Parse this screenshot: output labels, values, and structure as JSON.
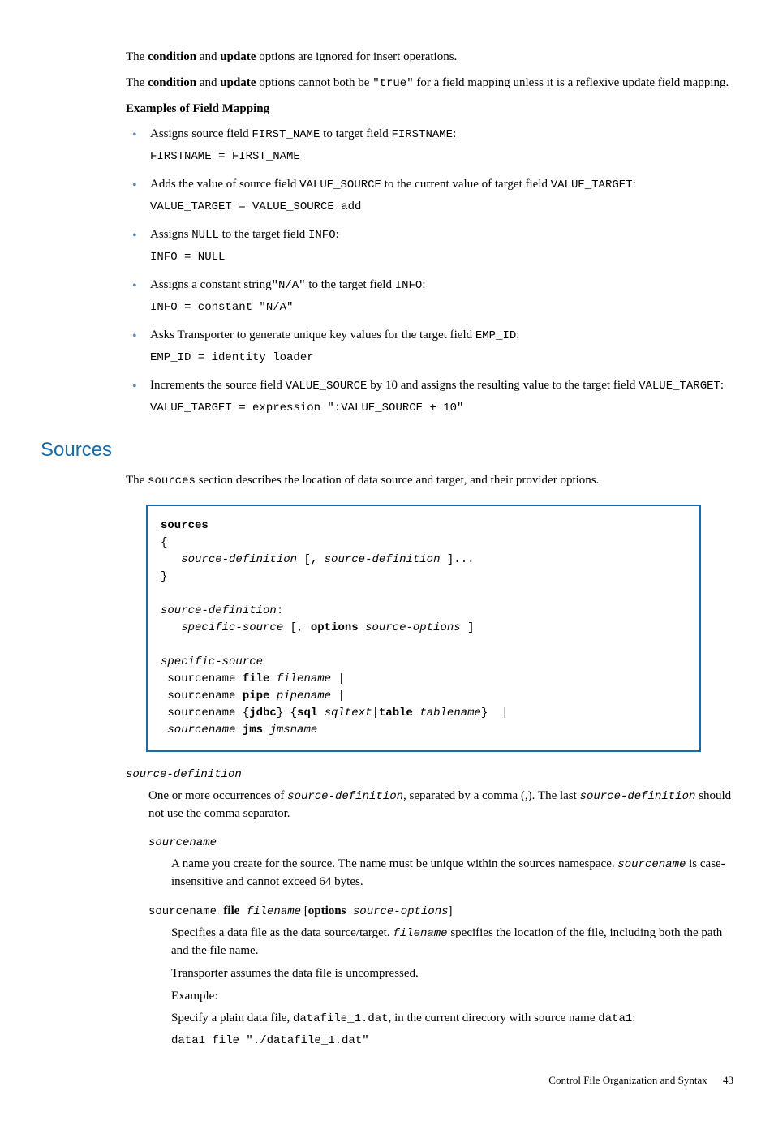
{
  "intro": {
    "p1_a": "The ",
    "p1_b": "condition",
    "p1_c": " and ",
    "p1_d": "update",
    "p1_e": " options are ignored for insert operations.",
    "p2_a": "The ",
    "p2_b": "condition",
    "p2_c": " and ",
    "p2_d": "update",
    "p2_e": " options cannot both be ",
    "p2_f": "\"true\"",
    "p2_g": " for a field mapping unless it is a reflexive update field mapping."
  },
  "examples_heading": "Examples of Field Mapping",
  "examples": [
    {
      "t1": "Assigns source field ",
      "c1": "FIRST_NAME",
      "t2": " to target field ",
      "c2": "FIRSTNAME",
      "t3": ":",
      "code": "FIRSTNAME = FIRST_NAME"
    },
    {
      "t1": "Adds the value of source field ",
      "c1": "VALUE_SOURCE",
      "t2": " to the current value of target field ",
      "c2": "VALUE_TARGET",
      "t3": ":",
      "code": "VALUE_TARGET = VALUE_SOURCE add"
    },
    {
      "t1": "Assigns ",
      "c1": "NULL",
      "t2": " to the target field ",
      "c2": "INFO",
      "t3": ":",
      "code": "INFO = NULL"
    },
    {
      "t1": "Assigns a constant string",
      "c1": "\"N/A\"",
      "t2": " to the target field ",
      "c2": "INFO",
      "t3": ":",
      "code": "INFO = constant \"N/A\""
    },
    {
      "t1": "Asks Transporter to generate unique key values for the target field ",
      "c1": "EMP_ID",
      "t2": "",
      "c2": "",
      "t3": ":",
      "code": "EMP_ID = identity loader"
    },
    {
      "t1": "Increments the source field ",
      "c1": "VALUE_SOURCE",
      "t2": " by 10 and assigns the resulting value to the target field ",
      "c2": "VALUE_TARGET",
      "t3": ":",
      "code": "VALUE_TARGET = expression \":VALUE_SOURCE + 10\""
    }
  ],
  "section_heading": "Sources",
  "section_intro_a": "The ",
  "section_intro_b": "sources",
  "section_intro_c": " section describes the location of data source and target, and their provider options.",
  "syntax": {
    "l01": "sources",
    "l02": "{",
    "l03a": "   ",
    "l03b": "source-definition",
    "l03c": " [, ",
    "l03d": "source-definition",
    "l03e": " ]...",
    "l04": "}",
    "l06": "source-definition",
    "l06b": ":",
    "l07a": "   ",
    "l07b": "specific-source",
    "l07c": " [, ",
    "l07d": "options",
    "l07e": " ",
    "l07f": "source-options",
    "l07g": " ]",
    "l09": "specific-source",
    "l10a": " sourcename ",
    "l10b": "file",
    "l10c": " ",
    "l10d": "filename",
    "l10e": " |",
    "l11a": " sourcename ",
    "l11b": "pipe",
    "l11c": " ",
    "l11d": "pipename",
    "l11e": " |",
    "l12a": " sourcename {",
    "l12b": "jdbc",
    "l12c": "} {",
    "l12d": "sql",
    "l12e": " ",
    "l12f": "sqltext",
    "l12g": "|",
    "l12h": "table",
    "l12i": " ",
    "l12j": "tablename",
    "l12k": "}  |",
    "l13a": " ",
    "l13b": "sourcename",
    "l13c": " ",
    "l13d": "jms",
    "l13e": " ",
    "l13f": "jmsname"
  },
  "defs": {
    "d1_term": "source-definition",
    "d1_def_a": "One or more occurrences of ",
    "d1_def_b": "source-definition",
    "d1_def_c": ", separated by a comma (,). The last ",
    "d1_def_d": "source-definition",
    "d1_def_e": " should not use the comma separator.",
    "d2_term": "sourcename",
    "d2_def_a": "A name you create for the source. The name must be unique within the sources namespace. ",
    "d2_def_b": "sourcename",
    "d2_def_c": " is case-insensitive and cannot exceed 64 bytes.",
    "d3_term_a": "sourcename ",
    "d3_term_b": "file",
    "d3_term_c": " ",
    "d3_term_d": "filename",
    "d3_term_e": " [",
    "d3_term_f": "options",
    "d3_term_g": " ",
    "d3_term_h": "source-options",
    "d3_term_i": "]",
    "d3_p1_a": "Specifies a data file as the data source/target. ",
    "d3_p1_b": "filename",
    "d3_p1_c": " specifies the location of the file, including both the path and the file name.",
    "d3_p2": "Transporter assumes the data file is uncompressed.",
    "d3_p3": "Example:",
    "d3_p4_a": "Specify a plain data file, ",
    "d3_p4_b": "datafile_1.dat",
    "d3_p4_c": ", in the current directory with source name ",
    "d3_p4_d": "data1",
    "d3_p4_e": ":",
    "d3_code": "data1 file \"./datafile_1.dat\""
  },
  "footer": {
    "label": "Control File Organization and Syntax",
    "page": "43"
  }
}
